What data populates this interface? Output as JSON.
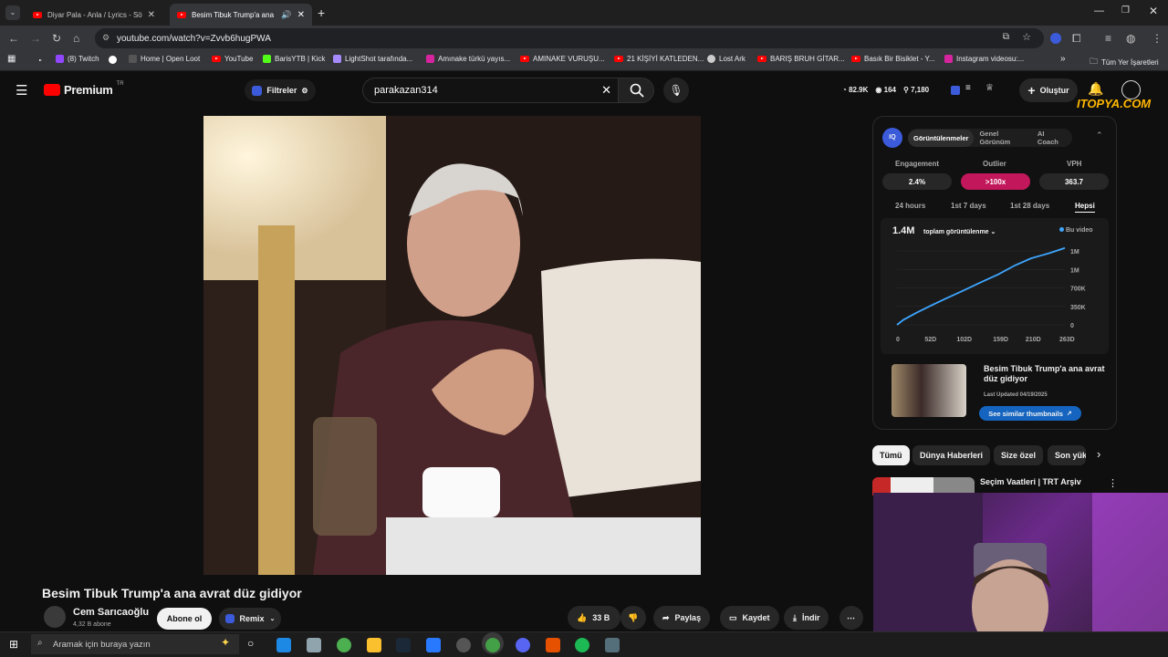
{
  "browser": {
    "tabs": [
      {
        "title": "Diyar Pala - Anla / Lyrics - Sözle"
      },
      {
        "title": "Besim Tibuk Trump'a ana avrat d"
      }
    ],
    "url": "youtube.com/watch?v=Zvvb6hugPWA",
    "bookmarks": [
      "(8) Twitch",
      "Home | Open Loot",
      "YouTube",
      "BarisYTB | Kick",
      "LightShot tarafında...",
      "Amınake türkü yayıs...",
      "AMINAKE VURUŞU...",
      "21 KİŞİYİ KATLEDEN...",
      "Lost Ark",
      "BARIŞ BRUH GİTAR...",
      "Basık Bir Bisiklet - Y...",
      "Instagram videosu:..."
    ],
    "all_bookmarks": "Tüm Yer İşaretleri",
    "colors": {
      "bg": "#35363a",
      "tab_bar": "#1f1f1f"
    }
  },
  "header": {
    "logo": "Premium",
    "logo_badge": "TR",
    "filters_label": "Filtreler",
    "search_value": "parakazan314",
    "stats": {
      "views": "82.9K",
      "eye": "164",
      "likes": "7,180"
    },
    "create_label": "Oluştur",
    "watermark": "ITOPYA.COM"
  },
  "iq_panel": {
    "tabs": [
      "Görüntülenmeler",
      "Genel Görünüm",
      "AI Coach"
    ],
    "metrics": [
      {
        "label": "Engagement",
        "value": "2.4%"
      },
      {
        "label": "Outlier",
        "value": ">100x"
      },
      {
        "label": "VPH",
        "value": "363.7"
      }
    ],
    "ranges": [
      "24 hours",
      "1st 7 days",
      "1st 28 days",
      "Hepsi"
    ],
    "total": "1.4M",
    "metric_select": "toplam görüntülenme",
    "legend": "Bu video",
    "video_title": "Besim Tibuk Trump'a ana avrat düz gidiyor",
    "last_updated": "Last Updated 04/19/2025",
    "similar_btn": "See similar thumbnails"
  },
  "chart_data": {
    "type": "line",
    "x_ticks": [
      "0",
      "52D",
      "102D",
      "159D",
      "210D",
      "263D"
    ],
    "y_ticks": [
      "1M",
      "1M",
      "700K",
      "350K",
      "0"
    ],
    "series": [
      {
        "name": "Bu video",
        "x": [
          0,
          10,
          30,
          52,
          75,
          102,
          130,
          159,
          185,
          210,
          240,
          263
        ],
        "y": [
          0,
          100000,
          240000,
          380000,
          520000,
          680000,
          850000,
          1020000,
          1200000,
          1340000,
          1450000,
          1550000
        ]
      }
    ],
    "ylim": [
      0,
      1600000
    ],
    "xlim": [
      0,
      263
    ],
    "color": "#3ea6ff"
  },
  "chips": [
    "Tümü",
    "Dünya Haberleri",
    "Size özel",
    "Son yük"
  ],
  "recommendation": {
    "title": "Seçim Vaatleri | TRT Arşiv"
  },
  "video": {
    "title": "Besim Tibuk Trump'a ana avrat düz gidiyor",
    "channel": "Cem Sarıcaoğlu",
    "subs": "4,32 B abone",
    "subscribe": "Abone ol",
    "remix": "Remix",
    "likes": "33 B",
    "share": "Paylaş",
    "save": "Kaydet",
    "download": "İndir"
  },
  "taskbar": {
    "search_placeholder": "Aramak için buraya yazın"
  }
}
